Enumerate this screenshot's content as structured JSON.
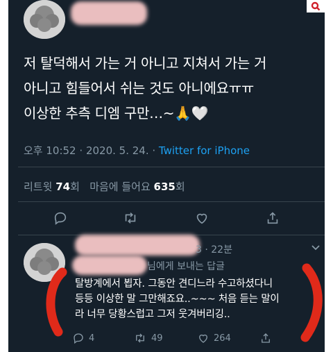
{
  "tweet": {
    "text": "저 탈덕해서 가는 거 아니고 지쳐서 가는 거\n아니고 힘들어서 쉬는 것도 아니에요ㅠㅠ\n이상한 추측 디엠 구만…~🙏🤍",
    "time": "오후 10:52",
    "date": "2020. 5. 24.",
    "source": "Twitter for iPhone",
    "retweets_label": "리트윗",
    "retweets_count": "74",
    "likes_label": "마음에 들어요",
    "likes_count": "635",
    "count_suffix": "회"
  },
  "reply": {
    "time": "3 · 22분",
    "replying_to": "님에게 보내는 답글",
    "text": "탈방계에서 뵙자. 그동안 견디느라 수고하셨다니\n등등 이상한 말 그만해죠요..~~~ 처음 듣는 말이\n라 너무 당황스럽고 그저 웃겨버리깅..",
    "reply_count": "4",
    "retweet_count": "49",
    "like_count": "264"
  },
  "colors": {
    "background": "#15202b",
    "text": "#ffffff",
    "muted": "#8899a6",
    "link": "#1da1f2",
    "annotation": "#e02a1a",
    "search_icon": "#d0202a"
  },
  "icons": [
    "search-icon",
    "reply-icon",
    "retweet-icon",
    "heart-icon",
    "share-icon",
    "chevron-down-icon"
  ]
}
